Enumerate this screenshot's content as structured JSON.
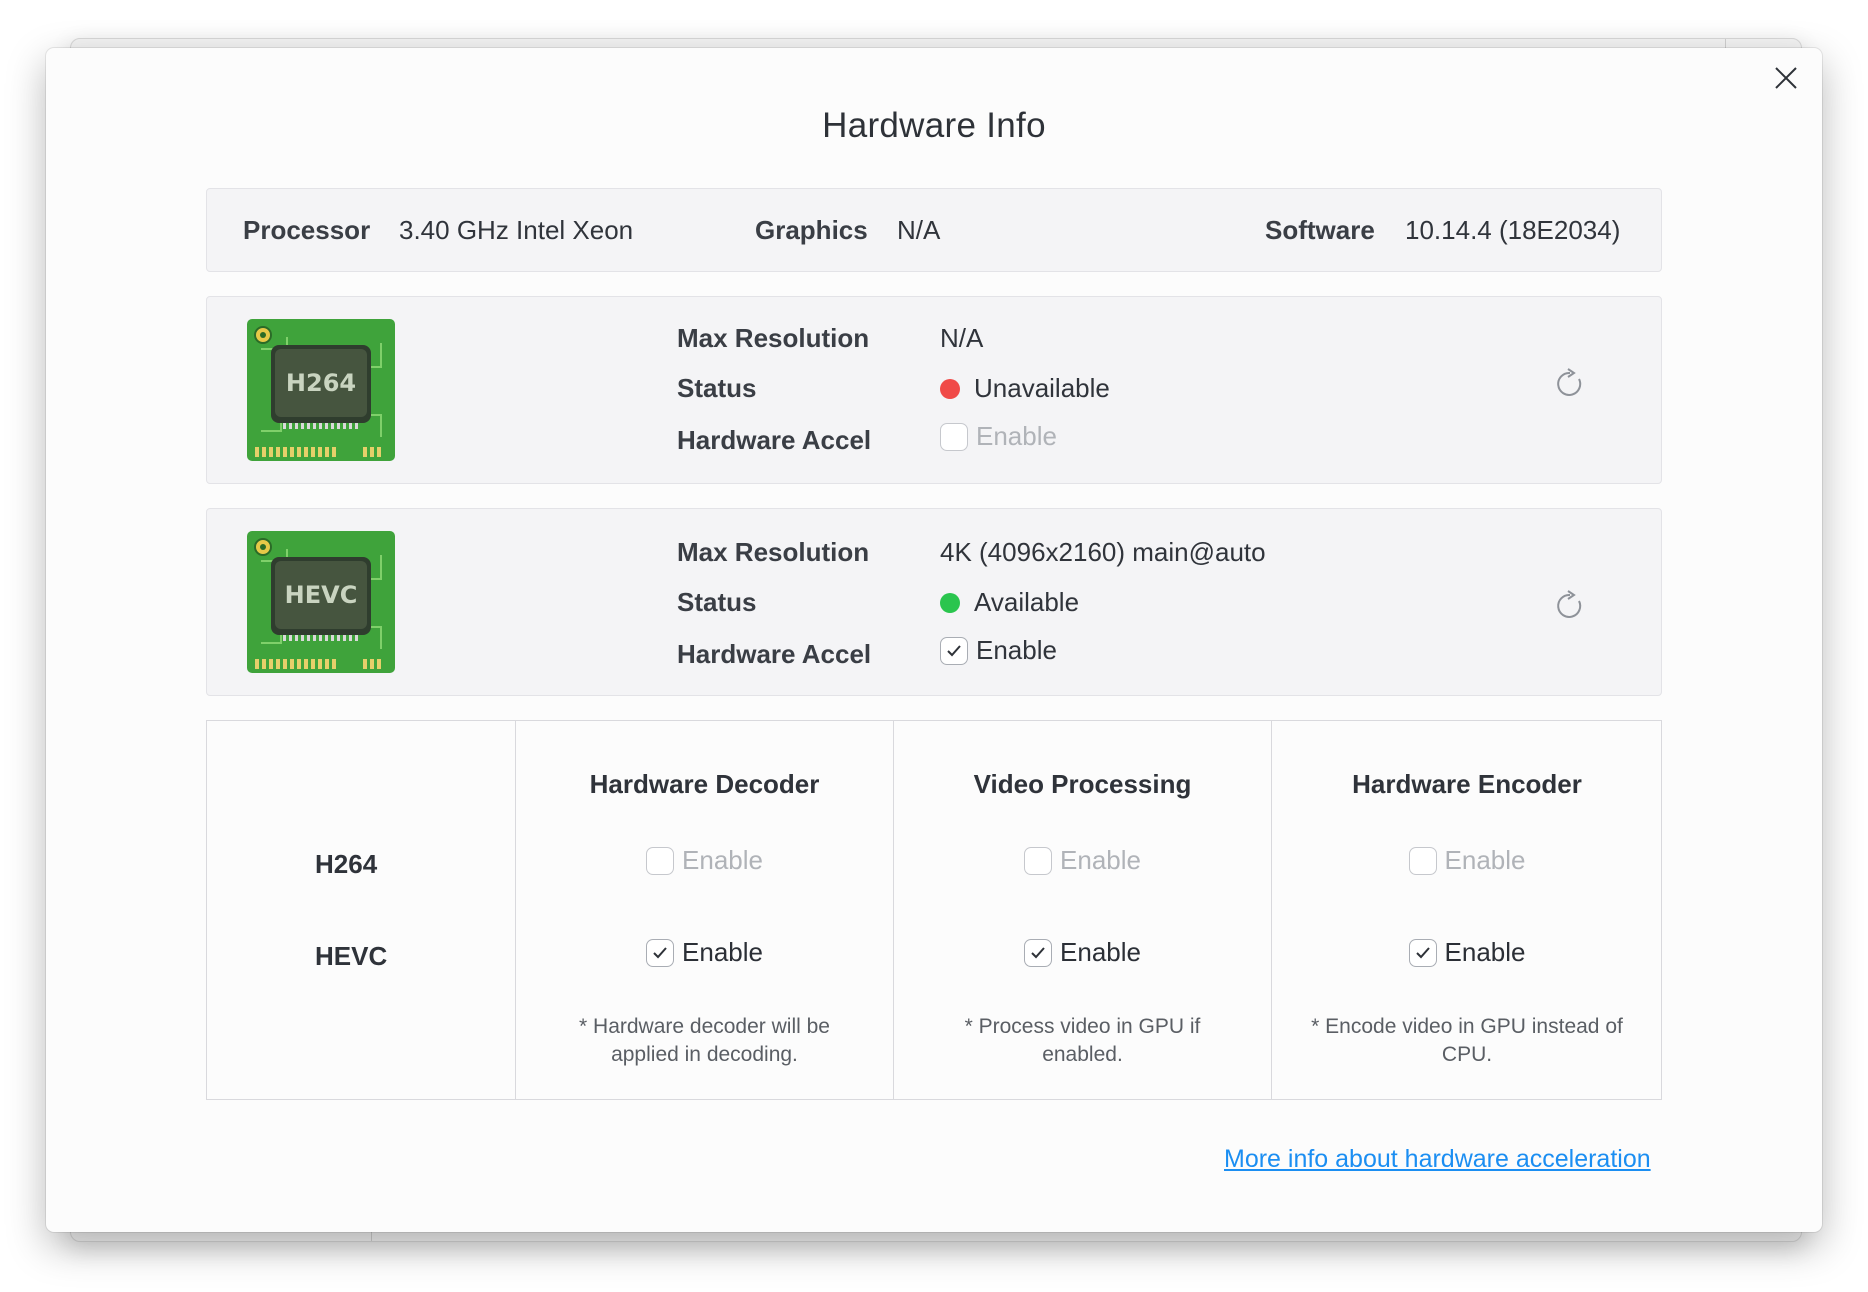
{
  "dialog": {
    "title": "Hardware Info",
    "more_info_link": "More info about hardware acceleration"
  },
  "system": {
    "processor_label": "Processor",
    "processor_value": "3.40 GHz Intel Xeon",
    "graphics_label": "Graphics",
    "graphics_value": "N/A",
    "software_label": "Software",
    "software_value": "10.14.4 (18E2034)"
  },
  "codecs": [
    {
      "chip_label": "H264",
      "max_res_label": "Max Resolution",
      "max_res_value": "N/A",
      "status_label": "Status",
      "status_value": "Unavailable",
      "status_color": "#f04a48",
      "accel_label": "Hardware Accel",
      "accel_checkbox_label": "Enable",
      "accel_checked": false,
      "accel_disabled": true
    },
    {
      "chip_label": "HEVC",
      "max_res_label": "Max Resolution",
      "max_res_value": "4K (4096x2160) main@auto",
      "status_label": "Status",
      "status_value": "Available",
      "status_color": "#2ac54e",
      "accel_label": "Hardware Accel",
      "accel_checkbox_label": "Enable",
      "accel_checked": true,
      "accel_disabled": false
    }
  ],
  "matrix": {
    "columns": [
      "Hardware Decoder",
      "Video Processing",
      "Hardware Encoder"
    ],
    "rows": [
      "H264",
      "HEVC"
    ],
    "cell_label": "Enable",
    "notes": [
      "* Hardware decoder will be applied in decoding.",
      "* Process video in GPU if enabled.",
      "* Encode video in GPU instead of CPU."
    ]
  },
  "colors": {
    "chip_green": "#3fa33b",
    "link_blue": "#1b8ef2"
  },
  "icons": {
    "close": "close-icon",
    "refresh": "refresh-icon",
    "check": "checkmark-icon"
  }
}
